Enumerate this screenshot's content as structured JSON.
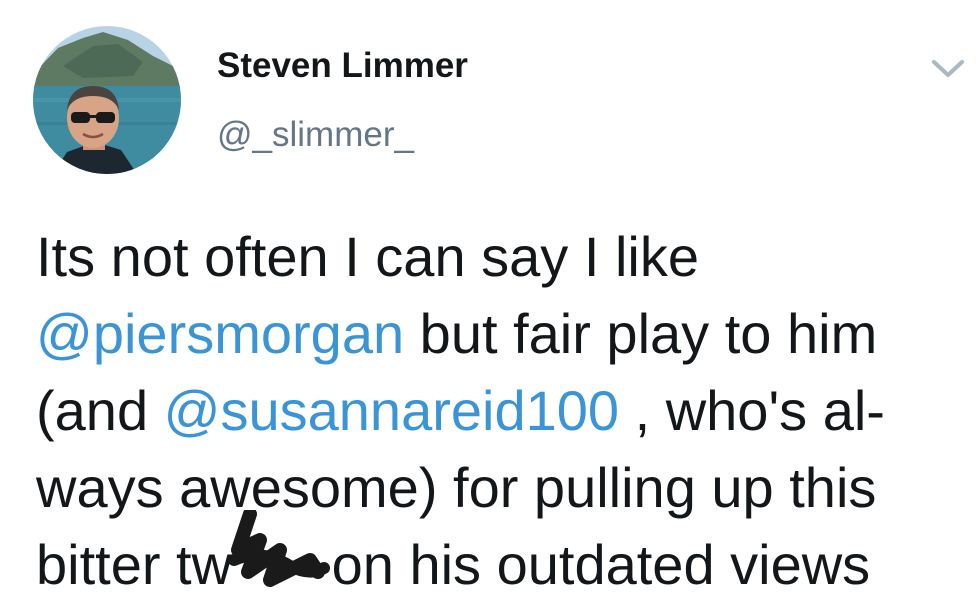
{
  "author": {
    "display_name": "Steven Limmer",
    "handle": "@_slimmer_"
  },
  "icons": {
    "caret": "chevron-down-icon"
  },
  "colors": {
    "mention": "#3a94d6",
    "handle": "#657786",
    "text": "#14171a"
  },
  "tweet": {
    "line1": "Its not often I can say I like",
    "line2_mention": "@piersmorgan",
    "line2_text": " but fair play to him",
    "line3_open": "(and ",
    "line3_mention": "@susannareid100",
    "line3_text": " , who's al-",
    "line4": "ways awesome) for pulling up this",
    "line5_start": "bitter tw",
    "line5_end": " on his outdated views"
  }
}
